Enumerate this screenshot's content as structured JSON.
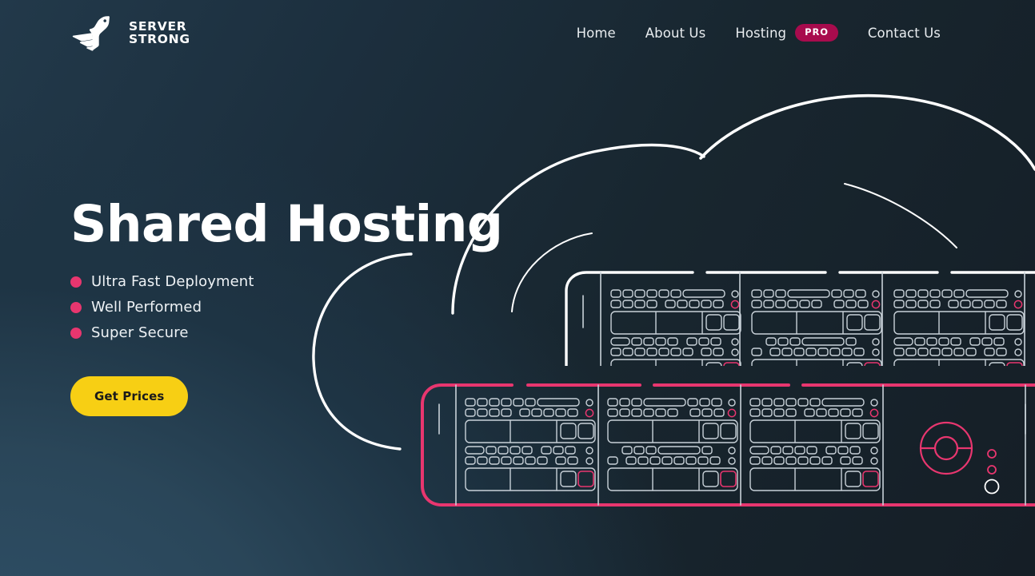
{
  "theme": {
    "background_dark": "#151e26",
    "background_light": "#2f5068",
    "accent_pink": "#e8366f",
    "accent_magenta": "#a80b4d",
    "accent_yellow": "#f7cf14",
    "line_white": "#ffffff",
    "line_gray": "#c9d2d9",
    "text_primary": "#ffffff"
  },
  "header": {
    "brand": {
      "icon": "pegasus-logo-icon",
      "line1": "SERVER",
      "line2": "STRONG"
    },
    "nav": [
      {
        "label": "Home",
        "name": "nav-link-home"
      },
      {
        "label": "About Us",
        "name": "nav-link-about-us"
      },
      {
        "label": "Hosting",
        "name": "nav-link-hosting",
        "badge": "PRO"
      },
      {
        "label": "Contact Us",
        "name": "nav-link-contact-us"
      }
    ],
    "badge_label": "PRO"
  },
  "hero": {
    "title": "Shared Hosting",
    "features": [
      "Ultra Fast Deployment",
      "Well Performed",
      "Super Secure"
    ],
    "cta_label": "Get Prices"
  },
  "illustration": {
    "name": "server-rack-cloud-illustration",
    "elements": [
      "cloud-outline-arcs",
      "upper-server-rack",
      "lower-server-rack-highlighted",
      "power-dial-icon",
      "status-leds"
    ]
  }
}
